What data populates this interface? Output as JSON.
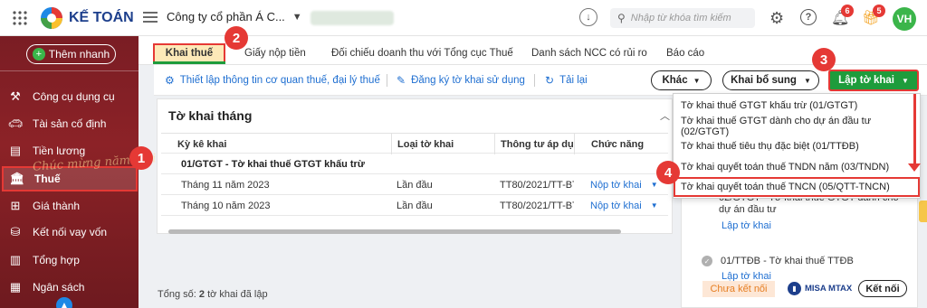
{
  "app": {
    "name": "KẾ TOÁN",
    "company": "Công ty cổ phần Á C...",
    "search_placeholder": "Nhập từ khóa tìm kiếm",
    "notifications": "6",
    "gifts": "5",
    "avatar": "VH"
  },
  "sidebar": {
    "add_button": "Thêm nhanh",
    "items": [
      {
        "label": "Công cụ dụng cụ",
        "icon": "tools-icon"
      },
      {
        "label": "Tài sản cố định",
        "icon": "car-icon"
      },
      {
        "label": "Tiền lương",
        "icon": "payroll-icon"
      },
      {
        "label": "Thuế",
        "icon": "tax-building-icon"
      },
      {
        "label": "Giá thành",
        "icon": "cost-icon"
      },
      {
        "label": "Kết nối vay vốn",
        "icon": "loan-icon"
      },
      {
        "label": "Tổng hợp",
        "icon": "summary-icon"
      },
      {
        "label": "Ngân sách",
        "icon": "budget-icon"
      }
    ],
    "banner_text": "Chúc mừng năm mới"
  },
  "tabs": [
    "Khai thuế",
    "Giấy nộp tiền",
    "Đối chiếu doanh thu với Tổng cục Thuế",
    "Danh sách NCC có rủi ro",
    "Báo cáo"
  ],
  "toolbar": {
    "setup": "Thiết lập thông tin cơ quan thuế, đại lý thuế",
    "register": "Đăng ký tờ khai sử dụng",
    "reload": "Tải lại",
    "other": "Khác",
    "supplement": "Khai bổ sung",
    "create": "Lập tờ khai"
  },
  "dropdown": [
    "Tờ khai thuế GTGT khấu trừ (01/GTGT)",
    "Tờ khai thuế GTGT dành cho dự án đầu tư (02/GTGT)",
    "Tờ khai thuế tiêu thụ đặc biệt (01/TTĐB)",
    "Tờ khai quyết toán thuế TNDN năm (03/TNDN)",
    "Tờ khai quyết toán thuế TNCN (05/QTT-TNCN)"
  ],
  "panel": {
    "title": "Tờ khai tháng",
    "columns": [
      "Kỳ kê khai",
      "Loại tờ khai",
      "Thông tư áp dụng",
      "Chức năng"
    ],
    "group": "01/GTGT - Tờ khai thuế GTGT khấu trừ",
    "rows": [
      {
        "period": "Tháng 11 năm 2023",
        "type": "Lần đầu",
        "circular": "TT80/2021/TT-BTC",
        "action": "Nộp tờ khai"
      },
      {
        "period": "Tháng 10 năm 2023",
        "type": "Lần đầu",
        "circular": "TT80/2021/TT-BTC",
        "action": "Nộp tờ khai"
      }
    ],
    "total_label": "Tổng số:",
    "total_count": "2",
    "total_suffix": "tờ khai đã lập"
  },
  "right_panel": {
    "item1_title": "02/GTGT - Tờ khai thuế GTGT dành cho dự án đầu tư",
    "item1_link": "Lập tờ khai",
    "item2_title": "01/TTĐB - Tờ khai thuế TTĐB",
    "item2_link": "Lập tờ khai",
    "status": "Chưa kết nối",
    "brand": "MISA MTAX",
    "connect": "Kết nối"
  },
  "steps": [
    "1",
    "2",
    "3",
    "4"
  ],
  "colors": {
    "accent_green": "#1e9c3c",
    "highlight_red": "#e53935",
    "link_blue": "#1f6fd1",
    "sidebar_red": "#8c2227"
  }
}
